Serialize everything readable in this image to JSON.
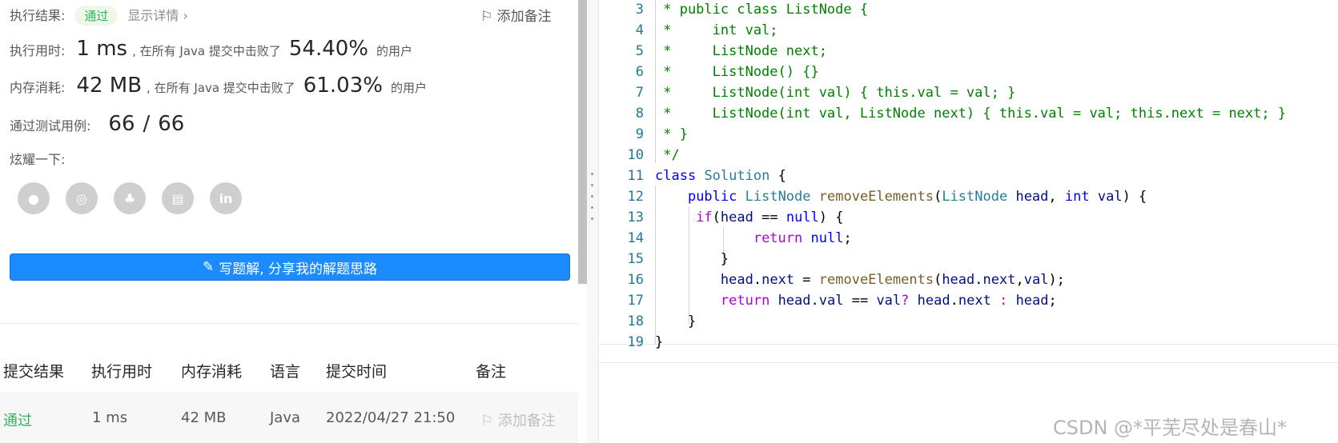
{
  "result": {
    "label": "执行结果:",
    "status": "通过",
    "detail_link": "显示详情",
    "add_note": "添加备注"
  },
  "runtime": {
    "label": "执行用时:",
    "value": "1 ms",
    "beat_text": ", 在所有 Java 提交中击败了",
    "percent": "54.40%",
    "suffix": "的用户"
  },
  "memory": {
    "label": "内存消耗:",
    "value": "42 MB",
    "beat_text": ", 在所有 Java 提交中击败了",
    "percent": "61.03%",
    "suffix": "的用户"
  },
  "tests": {
    "label": "通过测试用例:",
    "passed": "66",
    "sep": "/",
    "total": "66"
  },
  "share": {
    "label": "炫耀一下:",
    "icons": [
      "wechat-icon",
      "weibo-icon",
      "qq-icon",
      "douban-icon",
      "linkedin-icon"
    ]
  },
  "write_solution_button": "写题解, 分享我的解题思路",
  "table": {
    "headers": [
      "提交结果",
      "执行用时",
      "内存消耗",
      "语言",
      "提交时间",
      "备注"
    ],
    "rows": [
      {
        "result": "通过",
        "time": "1 ms",
        "memory": "42 MB",
        "lang": "Java",
        "submitted": "2022/04/27 21:50",
        "note": "添加备注"
      }
    ]
  },
  "code": {
    "line_numbers": [
      "3",
      "4",
      "5",
      "6",
      "7",
      "8",
      "9",
      "10",
      "11",
      "12",
      "13",
      "14",
      "15",
      "16",
      "17",
      "18",
      "19"
    ]
  },
  "watermark": "CSDN @*平芜尽处是春山*",
  "colors": {
    "accent": "#1a8cff",
    "success": "#2db55d",
    "comment": "#008000",
    "keyword": "#0000ff"
  }
}
